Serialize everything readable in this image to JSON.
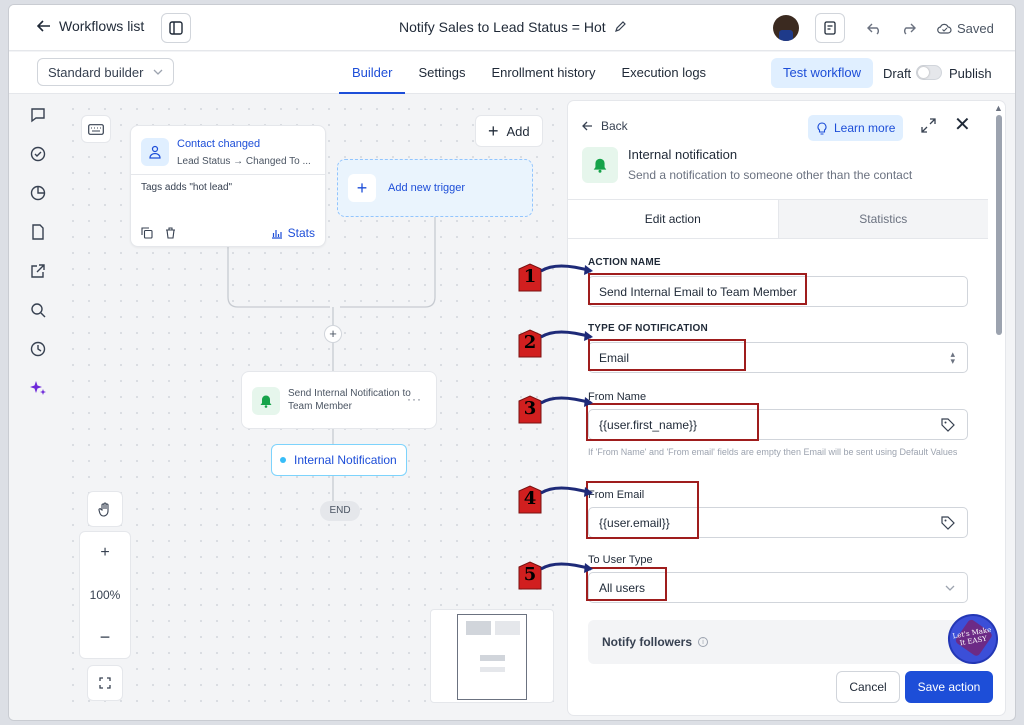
{
  "header": {
    "back_label": "Workflows list",
    "title": "Notify Sales to Lead Status = Hot",
    "saved_label": "Saved"
  },
  "toolbar": {
    "builder_select": "Standard builder",
    "tabs": [
      {
        "label": "Builder",
        "active": true
      },
      {
        "label": "Settings",
        "active": false
      },
      {
        "label": "Enrollment history",
        "active": false
      },
      {
        "label": "Execution logs",
        "active": false
      }
    ],
    "test_label": "Test workflow",
    "draft_label": "Draft",
    "publish_label": "Publish"
  },
  "rail": {
    "icons": [
      "chat-icon",
      "check-circle-icon",
      "pie-chart-icon",
      "document-icon",
      "external-link-icon",
      "search-icon",
      "history-icon",
      "sparkle-icon"
    ]
  },
  "canvas": {
    "add_label": "Add",
    "trigger": {
      "title": "Contact changed",
      "subtitle": "Lead Status → Changed To ...",
      "tags": "Tags adds \"hot lead\"",
      "stats_label": "Stats"
    },
    "add_trigger_label": "Add new trigger",
    "action_node": "Send Internal Notification to Team Member",
    "internal_chip": "Internal Notification",
    "end_label": "END",
    "zoom_level": "100%"
  },
  "panel": {
    "back_label": "Back",
    "learn_more_label": "Learn more",
    "title": "Internal notification",
    "description": "Send a notification to someone other than the contact",
    "tabs": [
      {
        "label": "Edit action",
        "active": true
      },
      {
        "label": "Statistics",
        "active": false
      }
    ],
    "fields": {
      "action_name_label": "ACTION NAME",
      "action_name_value": "Send Internal Email to Team Member",
      "type_label": "TYPE OF NOTIFICATION",
      "type_value": "Email",
      "from_name_label": "From Name",
      "from_name_value": "{{user.first_name}}",
      "help_text": "If 'From Name' and 'From email' fields are empty then Email will be sent using Default Values",
      "from_email_label": "From Email",
      "from_email_value": "{{user.email}}",
      "user_type_label": "To User Type",
      "user_type_value": "All users",
      "notify_followers_label": "Notify followers"
    },
    "cancel_label": "Cancel",
    "save_label": "Save action"
  },
  "annotations": {
    "badges": [
      "1",
      "2",
      "3",
      "4",
      "5"
    ],
    "box_color": "#9f1d1d",
    "badge_color": "#d11f1f",
    "logo_text": "Let's Make It EASY"
  },
  "colors": {
    "accent": "#1d4ed8",
    "green_icon_bg": "#e6f6ec",
    "blue_icon_bg": "#e0efff"
  }
}
